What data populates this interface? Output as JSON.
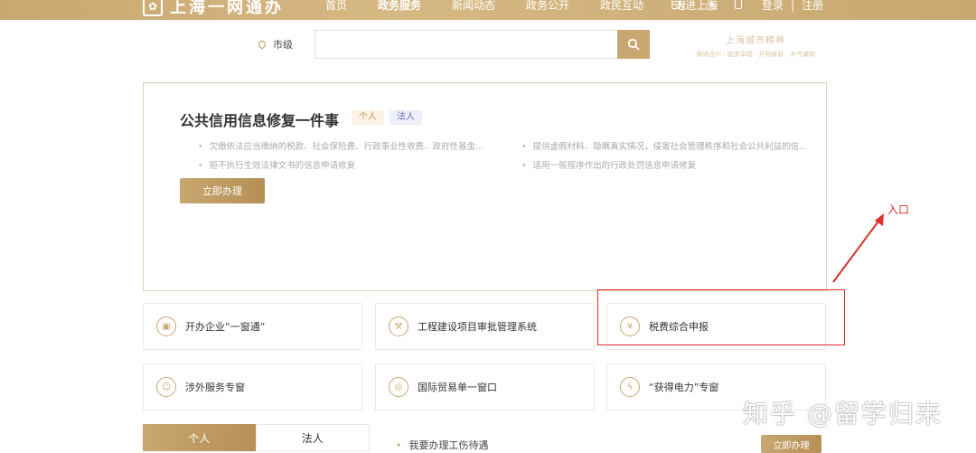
{
  "header": {
    "logo_text": "上海一网通办",
    "nav": [
      "首页",
      "政务服务",
      "新闻动态",
      "政务公开",
      "政民互动",
      "走进上海"
    ],
    "active_nav": 1,
    "lang": "EN",
    "login": "登录",
    "divider": "|",
    "register": "注册"
  },
  "search": {
    "location": "市级",
    "placeholder": ""
  },
  "spirit": {
    "title": "上海城市精神",
    "subtitle": "海纳百川 · 追求卓越 · 开明睿智 · 大气谦和"
  },
  "card": {
    "title": "公共信用信息修复一件事",
    "tag_personal": "个人",
    "tag_legal": "法人",
    "bullets": [
      "欠缴依法应当缴纳的税款、社会保险费、行政事业性收费、政府性基金...",
      "提供虚假材料、隐瞒真实情况，侵害社会管理秩序和社会公共利益的信...",
      "拒不执行生效法律文书的信息申请修复",
      "适用一般程序作出的行政处罚信息申请修复"
    ],
    "apply_label": "立即办理"
  },
  "annotation": {
    "entry_label": "入口"
  },
  "services": [
    "开办企业“一窗通”",
    "工程建设项目审批管理系统",
    "税费综合申报",
    "涉外服务专窗",
    "国际贸易单一窗口",
    "“获得电力”专窗"
  ],
  "tabs": {
    "personal": "个人",
    "legal": "法人"
  },
  "list": {
    "item": "我要办理工伤待遇",
    "apply_label": "立即办理"
  },
  "watermark": "知乎 @留学归来",
  "colors": {
    "brand_gold": "#c9a770",
    "annotation_red": "#d9302c"
  }
}
